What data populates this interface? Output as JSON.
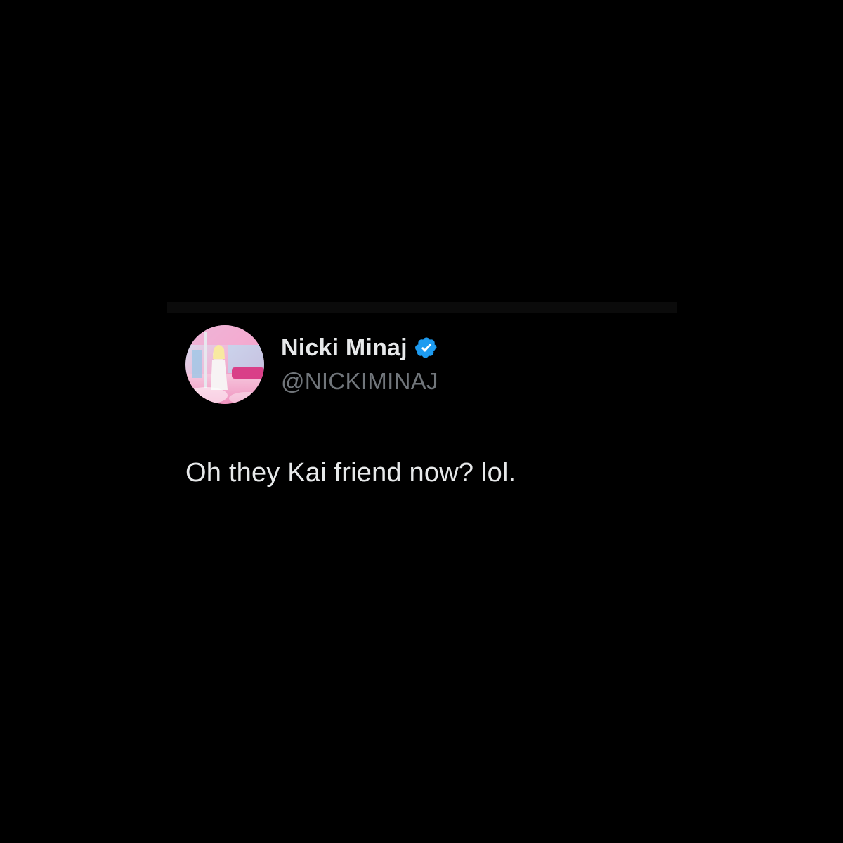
{
  "tweet": {
    "display_name": "Nicki Minaj",
    "handle": "@NICKIMINAJ",
    "text": "Oh they Kai friend now? lol.",
    "verified": true
  },
  "icons": {
    "verified": "verified-badge-icon",
    "avatar": "profile-avatar"
  },
  "colors": {
    "background": "#000000",
    "name": "#e7e9ea",
    "handle": "#71767b",
    "text": "#e7e9ea",
    "verified_badge": "#1d9bf0"
  }
}
